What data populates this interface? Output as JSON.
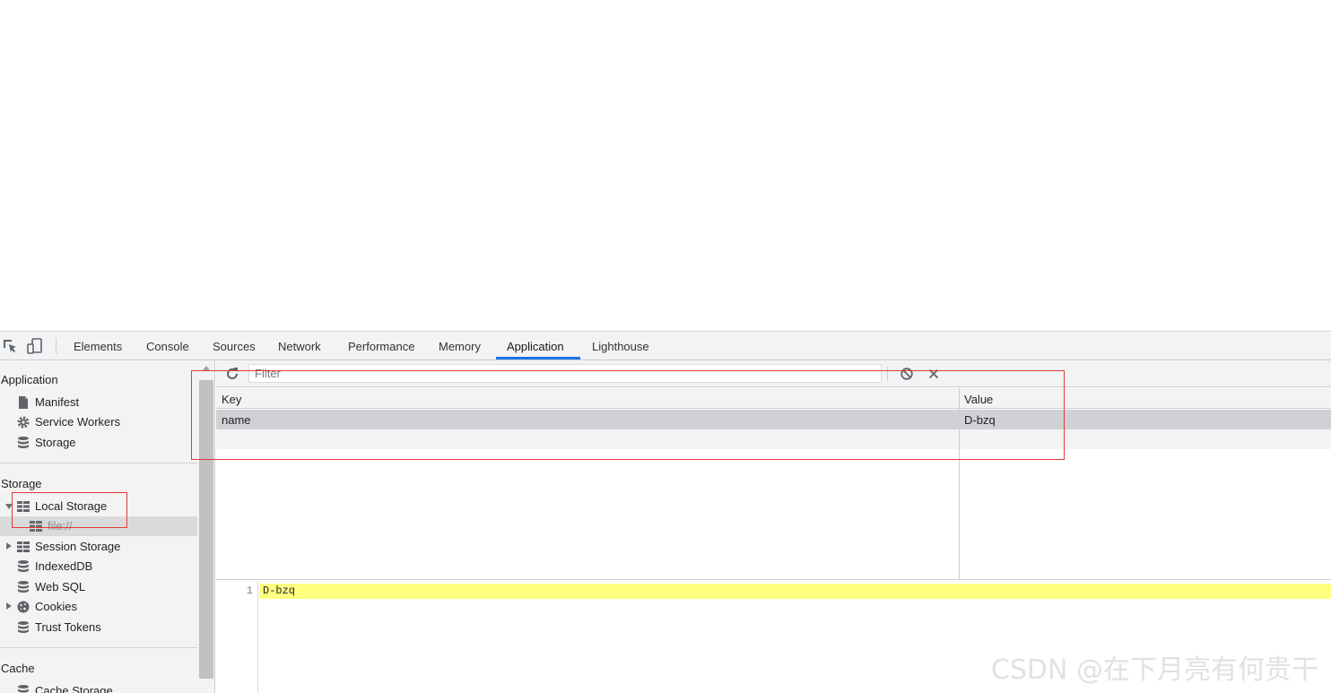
{
  "tabs": [
    {
      "label": "Elements"
    },
    {
      "label": "Console"
    },
    {
      "label": "Sources"
    },
    {
      "label": "Network"
    },
    {
      "label": "Performance"
    },
    {
      "label": "Memory"
    },
    {
      "label": "Application"
    },
    {
      "label": "Lighthouse"
    }
  ],
  "active_tab": "Application",
  "sidebar": {
    "application": {
      "title": "Application",
      "items": [
        {
          "label": "Manifest",
          "icon": "file-icon"
        },
        {
          "label": "Service Workers",
          "icon": "gear-icon"
        },
        {
          "label": "Storage",
          "icon": "database-icon"
        }
      ]
    },
    "storage": {
      "title": "Storage",
      "items": [
        {
          "label": "Local Storage",
          "icon": "grid-icon",
          "expanded": true
        },
        {
          "label": "file://",
          "icon": "grid-icon",
          "selected": true
        },
        {
          "label": "Session Storage",
          "icon": "grid-icon"
        },
        {
          "label": "IndexedDB",
          "icon": "database-icon"
        },
        {
          "label": "Web SQL",
          "icon": "database-icon"
        },
        {
          "label": "Cookies",
          "icon": "cookie-icon"
        },
        {
          "label": "Trust Tokens",
          "icon": "database-icon"
        }
      ]
    },
    "cache": {
      "title": "Cache",
      "items": [
        {
          "label": "Cache Storage",
          "icon": "database-icon"
        }
      ]
    }
  },
  "toolbar": {
    "filter_placeholder": "Filter"
  },
  "table": {
    "headers": {
      "key": "Key",
      "value": "Value"
    },
    "rows": [
      {
        "key": "name",
        "value": "D-bzq"
      }
    ]
  },
  "preview": {
    "line_number": "1",
    "text": "D-bzq"
  },
  "watermark": "CSDN @在下月亮有何贵干",
  "colors": {
    "accent": "#1a73e8",
    "highlight_box": "#e53935",
    "preview_highlight": "#ffff80"
  }
}
